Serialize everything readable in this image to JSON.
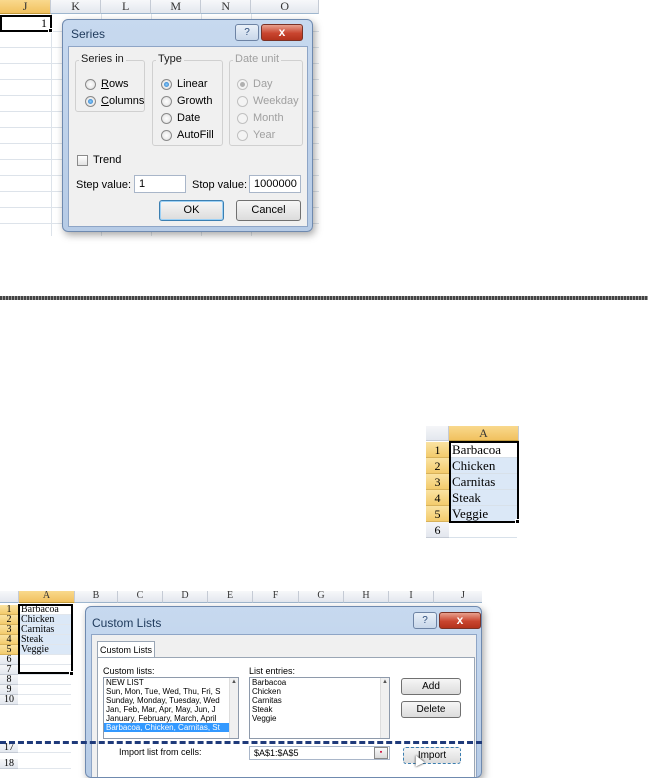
{
  "top_sheet": {
    "columns": [
      "J",
      "K",
      "L",
      "M",
      "N",
      "O"
    ],
    "active_cell_value": "1"
  },
  "series_dialog": {
    "title": "Series",
    "help_label": "?",
    "close_label": "x",
    "series_in": {
      "label": "Series in",
      "options": [
        {
          "label": "Rows",
          "accel": "R",
          "rest": "ows",
          "selected": false
        },
        {
          "label": "Columns",
          "accel": "C",
          "rest": "olumns",
          "selected": true
        }
      ]
    },
    "type": {
      "label": "Type",
      "options": [
        {
          "label": "Linear",
          "selected": true
        },
        {
          "label": "Growth",
          "selected": false
        },
        {
          "label": "Date",
          "selected": false
        },
        {
          "label": "AutoFill",
          "selected": false
        }
      ]
    },
    "date_unit": {
      "label": "Date unit",
      "options": [
        {
          "label": "Day",
          "selected": true
        },
        {
          "label": "Weekday",
          "selected": false
        },
        {
          "label": "Month",
          "selected": false
        },
        {
          "label": "Year",
          "selected": false
        }
      ]
    },
    "trend_label": "Trend",
    "step_label": "Step value:",
    "step_value": "1",
    "stop_label": "Stop value:",
    "stop_value": "1000000",
    "ok_label": "OK",
    "cancel_label": "Cancel"
  },
  "small_table": {
    "column": "A",
    "rows": [
      {
        "num": "1",
        "value": "Barbacoa"
      },
      {
        "num": "2",
        "value": "Chicken"
      },
      {
        "num": "3",
        "value": "Carnitas"
      },
      {
        "num": "4",
        "value": "Steak"
      },
      {
        "num": "5",
        "value": "Veggie"
      },
      {
        "num": "6",
        "value": ""
      }
    ]
  },
  "bottom_sheet": {
    "columns": [
      "A",
      "B",
      "C",
      "D",
      "E",
      "F",
      "G",
      "H",
      "I",
      "J"
    ],
    "rows": [
      {
        "num": "1",
        "value": "Barbacoa"
      },
      {
        "num": "2",
        "value": "Chicken"
      },
      {
        "num": "3",
        "value": "Carnitas"
      },
      {
        "num": "4",
        "value": "Steak"
      },
      {
        "num": "5",
        "value": "Veggie"
      },
      {
        "num": "6",
        "value": ""
      },
      {
        "num": "7",
        "value": ""
      },
      {
        "num": "8",
        "value": ""
      },
      {
        "num": "9",
        "value": ""
      },
      {
        "num": "10",
        "value": ""
      },
      {
        "num": "17",
        "value": ""
      },
      {
        "num": "18",
        "value": ""
      }
    ]
  },
  "custom_lists_dialog": {
    "title": "Custom Lists",
    "help_label": "?",
    "close_label": "x",
    "tab_label": "Custom Lists",
    "custom_lists_label": "Custom lists:",
    "custom_lists": [
      "NEW LIST",
      "Sun, Mon, Tue, Wed, Thu, Fri, S",
      "Sunday, Monday, Tuesday, Wed",
      "Jan, Feb, Mar, Apr, May, Jun, J",
      "January, February, March, April",
      "Barbacoa, Chicken, Carnitas, St"
    ],
    "list_entries_label": "List entries:",
    "list_entries": [
      "Barbacoa",
      "Chicken",
      "Carnitas",
      "Steak",
      "Veggie"
    ],
    "add_label": "Add",
    "delete_label": "Delete",
    "import_from_label": "Import list from cells:",
    "import_range": "$A$1:$A$5",
    "import_label": "Import"
  }
}
